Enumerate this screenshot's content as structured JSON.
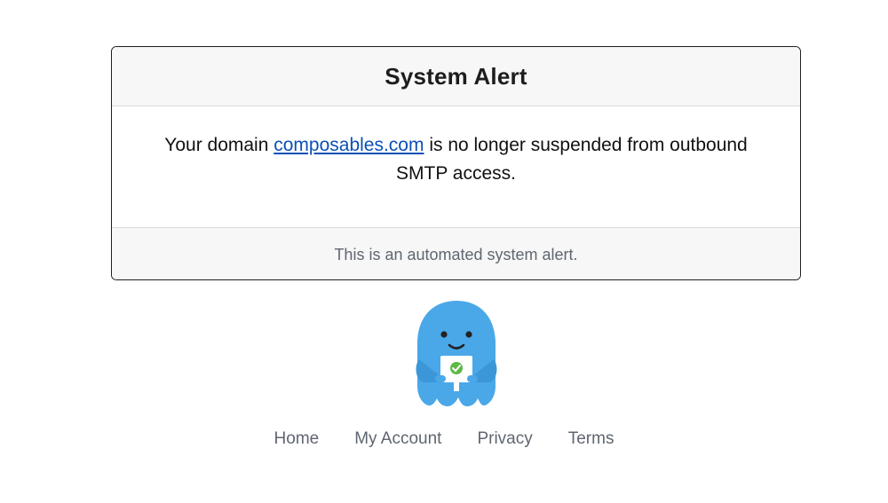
{
  "alert": {
    "title": "System Alert",
    "message_prefix": "Your domain ",
    "domain_link": "composables.com",
    "message_suffix": " is no longer suspended from outbound SMTP access.",
    "footer_text": "This is an automated system alert."
  },
  "mascot": {
    "icon": "blue-monster-holding-shield-sign",
    "colors": {
      "body": "#4aa8e8",
      "badge": "#5cb946"
    }
  },
  "footer_nav": {
    "items": [
      {
        "label": "Home"
      },
      {
        "label": "My Account"
      },
      {
        "label": "Privacy"
      },
      {
        "label": "Terms"
      }
    ]
  },
  "colors": {
    "link": "#0b50b5",
    "muted_text": "#5f6670",
    "panel_bg": "#f7f7f7"
  }
}
